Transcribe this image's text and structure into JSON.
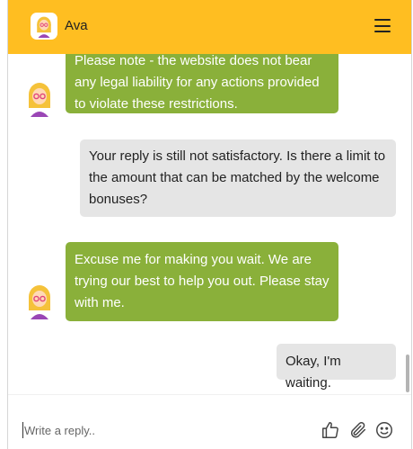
{
  "header": {
    "agent_name": "Ava",
    "brand_color": "#ffbe21"
  },
  "messages": [
    {
      "from": "bot",
      "lines": [
        "Please note - the website does not bear",
        "any legal liability for any actions provided",
        "to violate these restrictions."
      ]
    },
    {
      "from": "user",
      "lines": [
        "Your reply is still not satisfactory. Is there a limit to",
        "the amount that can be matched by the welcome",
        "bonuses?"
      ]
    },
    {
      "from": "bot",
      "lines": [
        "Excuse me for making you wait. We are",
        "trying our best to help you out. Please stay",
        "with me."
      ]
    },
    {
      "from": "user",
      "lines": [
        "Okay, I'm waiting."
      ]
    }
  ],
  "composer": {
    "placeholder": "Write a reply.."
  },
  "colors": {
    "bot_bubble": "#8ab03a",
    "user_bubble": "#e5e5e5"
  },
  "icons": [
    "menu-icon",
    "thumbs-up-icon",
    "paperclip-icon",
    "emoji-icon",
    "avatar-icon"
  ]
}
